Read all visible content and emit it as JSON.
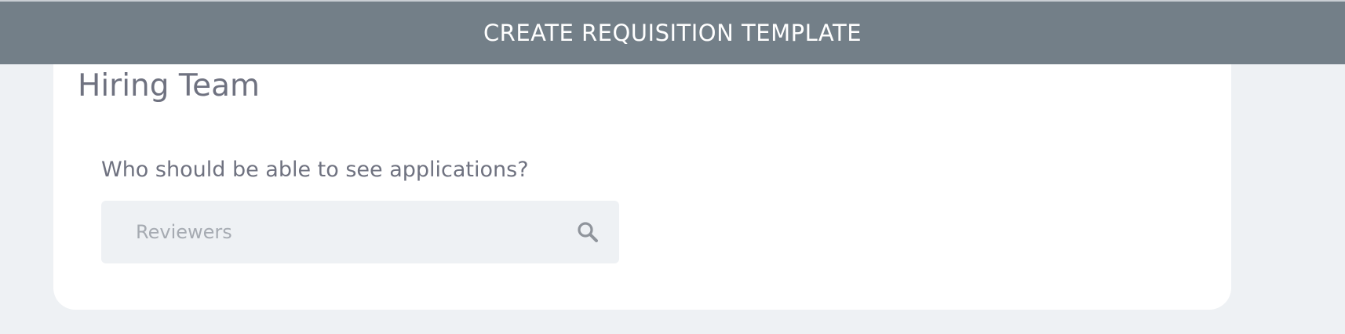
{
  "header": {
    "title": "CREATE REQUISITION TEMPLATE"
  },
  "section": {
    "title": "Hiring Team"
  },
  "reviewers": {
    "question": "Who should be able to see applications?",
    "placeholder": "Reviewers",
    "value": "",
    "icon": "search-icon"
  },
  "colors": {
    "header_bg": "#737f88",
    "page_bg": "#eef1f4",
    "card_bg": "#ffffff",
    "text": "#6f7280",
    "placeholder": "#a6abb2"
  }
}
